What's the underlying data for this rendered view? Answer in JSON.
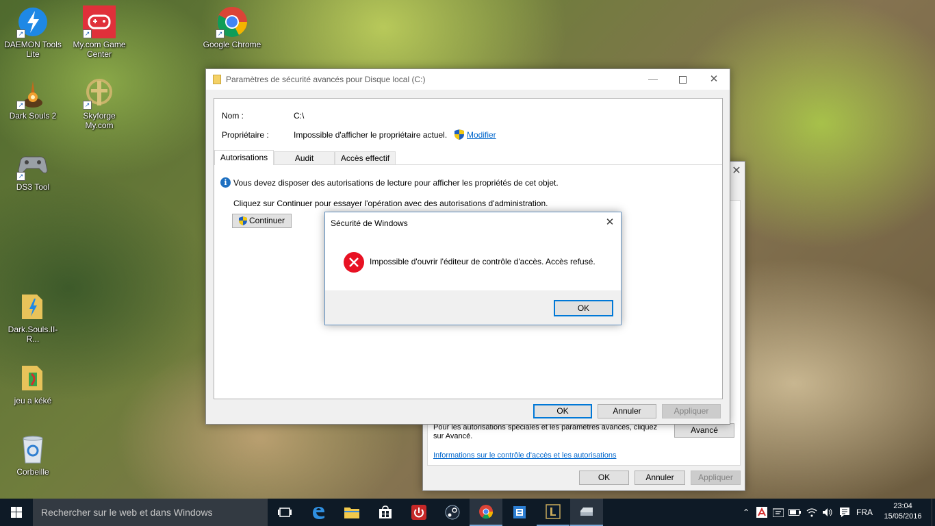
{
  "desktop": {
    "icons": [
      {
        "label": "DAEMON Tools Lite"
      },
      {
        "label": "My.com Game Center"
      },
      {
        "label": "Google Chrome"
      },
      {
        "label": "Dark Souls 2"
      },
      {
        "label": "Skyforge My.com"
      },
      {
        "label": "DS3 Tool"
      },
      {
        "label": "Dark.Souls.II-R..."
      },
      {
        "label": "jeu a kéké"
      },
      {
        "label": "Corbeille"
      }
    ]
  },
  "back_window": {
    "special_text": "Pour les autorisations spéciales et les paramètres avancés, cliquez sur Avancé.",
    "advanced_label": "Avancé",
    "link_text": "Informations sur le contrôle d'accès et les autorisations",
    "ok_label": "OK",
    "cancel_label": "Annuler",
    "apply_label": "Appliquer"
  },
  "main_window": {
    "title": "Paramètres de sécurité avancés pour Disque local (C:)",
    "name_label": "Nom :",
    "name_value": "C:\\",
    "owner_label": "Propriétaire :",
    "owner_value": "Impossible d'afficher le propriétaire actuel.",
    "modify_link": "Modifier",
    "tabs": [
      {
        "label": "Autorisations"
      },
      {
        "label": "Audit"
      },
      {
        "label": "Accès effectif"
      }
    ],
    "info_text": "Vous devez disposer des autorisations de lecture pour afficher les propriétés de cet objet.",
    "continue_text": "Cliquez sur Continuer pour essayer l'opération avec des autorisations d'administration.",
    "continue_label": "Continuer",
    "ok_label": "OK",
    "cancel_label": "Annuler",
    "apply_label": "Appliquer"
  },
  "dialog": {
    "title": "Sécurité de Windows",
    "message": "Impossible d'ouvrir l'éditeur de contrôle d'accès. Accès refusé.",
    "ok_label": "OK"
  },
  "taskbar": {
    "search_placeholder": "Rechercher sur le web et dans Windows",
    "language": "FRA",
    "time": "23:04",
    "date": "15/05/2016"
  },
  "colors": {
    "accent": "#0078d7",
    "taskbar": "#0e1a26",
    "error": "#e81123",
    "link": "#0066cc"
  }
}
